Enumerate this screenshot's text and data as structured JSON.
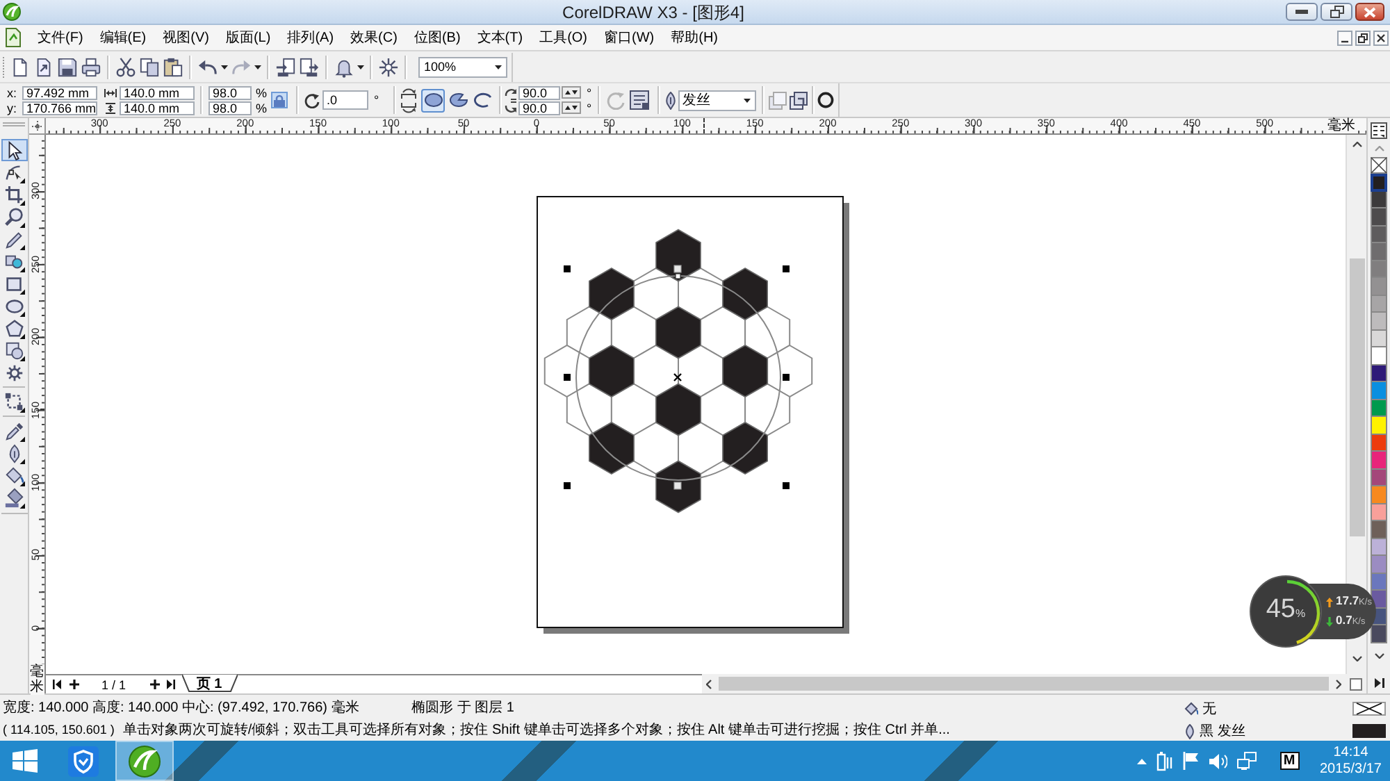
{
  "window": {
    "title": "CorelDRAW X3 - [图形4]"
  },
  "menu": [
    "文件(F)",
    "编辑(E)",
    "视图(V)",
    "版面(L)",
    "排列(A)",
    "效果(C)",
    "位图(B)",
    "文本(T)",
    "工具(O)",
    "窗口(W)",
    "帮助(H)"
  ],
  "standard_toolbar": {
    "zoom": "100%"
  },
  "property_bar": {
    "position": [
      {
        "label": "x:",
        "value": "97.492 mm"
      },
      {
        "label": "y:",
        "value": "170.766 mm"
      }
    ],
    "size": [
      "140.0 mm",
      "140.0 mm"
    ],
    "scale": [
      {
        "value": "98.0",
        "unit": "%"
      },
      {
        "value": "98.0",
        "unit": "%"
      }
    ],
    "lock_ratio": {
      "on": true
    },
    "rotation": {
      "value": ".0",
      "unit": "°"
    },
    "shape_modes": [
      {
        "kind": "ellipse",
        "selected": true
      },
      {
        "kind": "pie",
        "selected": false
      },
      {
        "kind": "arc",
        "selected": false
      }
    ],
    "angles": [
      {
        "value": "90.0",
        "unit": "°"
      },
      {
        "value": "90.0",
        "unit": "°"
      }
    ],
    "outline_width": "发丝"
  },
  "toolbox": {
    "tools": [
      {
        "kind": "pick",
        "selected": true
      },
      {
        "kind": "shape",
        "selected": false
      },
      {
        "kind": "crop",
        "selected": false
      },
      {
        "kind": "zoom",
        "selected": false
      },
      {
        "kind": "freehand",
        "selected": false
      },
      {
        "kind": "smart_fill",
        "selected": false
      },
      {
        "kind": "rectangle",
        "selected": false
      },
      {
        "kind": "ellipse",
        "selected": false
      },
      {
        "kind": "polygon",
        "selected": false
      },
      {
        "kind": "basic_shapes",
        "selected": false
      },
      {
        "kind": "gear",
        "selected": false
      },
      {
        "kind": "interactive",
        "selected": false
      },
      {
        "kind": "eyedropper",
        "selected": false
      },
      {
        "kind": "outline",
        "selected": false
      },
      {
        "kind": "fill",
        "selected": false
      },
      {
        "kind": "interactive_fill",
        "selected": false
      }
    ]
  },
  "rulers": {
    "horizontal": {
      "labels": [
        "300",
        "250",
        "200",
        "150",
        "100",
        "50",
        "0",
        "50",
        "100",
        "150",
        "200",
        "250",
        "300",
        "350",
        "400",
        "450",
        "500"
      ],
      "unit": "毫米"
    },
    "vertical": {
      "labels": [
        "300",
        "250",
        "200",
        "150",
        "100",
        "50",
        "0"
      ],
      "unit": "毫米"
    }
  },
  "color_palette": {
    "swatches": [
      {
        "color": "#231f20",
        "selected": true
      },
      {
        "color": "#3c3a3b",
        "selected": false
      },
      {
        "color": "#4d4b4c",
        "selected": false
      },
      {
        "color": "#5e5c5d",
        "selected": false
      },
      {
        "color": "#6f6d6e",
        "selected": false
      },
      {
        "color": "#807e7f",
        "selected": false
      },
      {
        "color": "#939192",
        "selected": false
      },
      {
        "color": "#a7a5a6",
        "selected": false
      },
      {
        "color": "#bdbbbc",
        "selected": false
      },
      {
        "color": "#d9d8d8",
        "selected": false
      },
      {
        "color": "#ffffff",
        "selected": false
      },
      {
        "color": "#2e1a78",
        "selected": false
      },
      {
        "color": "#0a8fe0",
        "selected": false
      },
      {
        "color": "#009a4e",
        "selected": false
      },
      {
        "color": "#fff200",
        "selected": false
      },
      {
        "color": "#ed3b0d",
        "selected": false
      },
      {
        "color": "#e8247a",
        "selected": false
      },
      {
        "color": "#a4477a",
        "selected": false
      },
      {
        "color": "#f7891f",
        "selected": false
      },
      {
        "color": "#f9a09a",
        "selected": false
      },
      {
        "color": "#6e6059",
        "selected": false
      },
      {
        "color": "#bcb1d8",
        "selected": false
      },
      {
        "color": "#9b8cc2",
        "selected": false
      },
      {
        "color": "#6b77bd",
        "selected": false
      },
      {
        "color": "#6a5aa0",
        "selected": false
      },
      {
        "color": "#47547e",
        "selected": false
      },
      {
        "color": "#4a4a5e",
        "selected": false
      }
    ]
  },
  "page_navigator": {
    "counter": "1 / 1",
    "tabs": [
      {
        "label": "页 1",
        "selected": true
      }
    ]
  },
  "status_bar": {
    "object_info": "宽度: 140.000 高度: 140.000 中心: (97.492, 170.766) 毫米",
    "layer_info": "椭圆形 于 图层 1",
    "cursor_position": "( 114.105, 150.601 )",
    "hint": "单击对象两次可旋转/倾斜；双击工具可选择所有对象；按住 Shift 键单击可选择多个对象；按住 Alt 键单击可进行挖掘；按住 Ctrl 并单...",
    "fill": "无",
    "outline": "黑 发丝"
  },
  "resource_monitor": {
    "usage": {
      "value": "45",
      "unit": "%"
    },
    "level": 0.45,
    "upload": {
      "value": "17.7",
      "unit": "K/s"
    },
    "download": {
      "value": "0.7",
      "unit": "K/s"
    }
  },
  "taskbar": {
    "apps": [
      {
        "kind": "shield",
        "selected": false
      },
      {
        "kind": "coreldraw",
        "selected": true
      }
    ],
    "ime": "M",
    "time": "14:14",
    "date": "2015/3/17"
  }
}
